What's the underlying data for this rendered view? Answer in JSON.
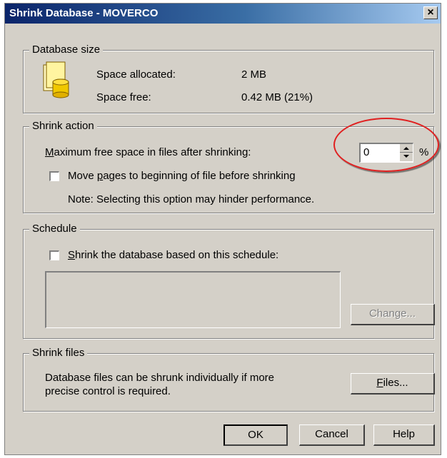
{
  "window": {
    "title": "Shrink Database - MOVERCO",
    "close_glyph": "×"
  },
  "database_size": {
    "legend": "Database size",
    "icon": "database-icon",
    "space_allocated_label": "Space allocated:",
    "space_allocated_value": "2 MB",
    "space_free_label": "Space free:",
    "space_free_value": "0.42 MB (21%)"
  },
  "shrink_action": {
    "legend": "Shrink action",
    "max_free_label_first": "M",
    "max_free_label_rest": "aximum free space in files after shrinking:",
    "max_free_value": "0",
    "max_free_unit": "%",
    "move_pages_pre": "Move ",
    "move_pages_key": "p",
    "move_pages_post": "ages to beginning of file before shrinking",
    "move_pages_checked": false,
    "note": "Note: Selecting this option may hinder performance.",
    "highlight_color": "#e02020"
  },
  "schedule": {
    "legend": "Schedule",
    "checkbox_key": "S",
    "checkbox_rest": "hrink the database based on this schedule:",
    "checkbox_checked": false,
    "change_key": "g",
    "change_pre": "Chan",
    "change_post": "e..."
  },
  "shrink_files": {
    "legend": "Shrink files",
    "description_line1": "Database files can be shrunk individually if more",
    "description_line2": "precise control is required.",
    "files_key": "F",
    "files_rest": "iles..."
  },
  "buttons": {
    "ok": "OK",
    "cancel": "Cancel",
    "help": "Help"
  }
}
